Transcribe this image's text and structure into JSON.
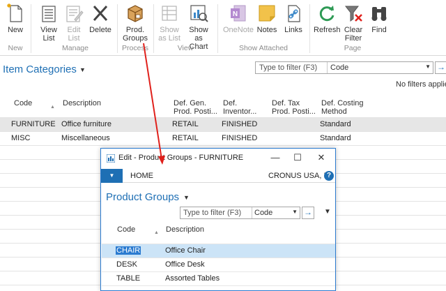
{
  "ribbon": {
    "buttons": [
      {
        "label": "New",
        "icon": "new-document-icon"
      },
      {
        "label": "View\nList",
        "icon": "view-list-icon"
      },
      {
        "label": "Edit\nList",
        "icon": "edit-list-icon"
      },
      {
        "label": "Delete",
        "icon": "delete-x-icon"
      },
      {
        "label": "Prod.\nGroups",
        "icon": "product-groups-box-icon"
      },
      {
        "label": "Show\nas List",
        "icon": "show-as-list-icon"
      },
      {
        "label": "Show as\nChart",
        "icon": "show-as-chart-icon"
      },
      {
        "label": "OneNote",
        "icon": "onenote-icon"
      },
      {
        "label": "Notes",
        "icon": "notes-icon"
      },
      {
        "label": "Links",
        "icon": "links-icon"
      },
      {
        "label": "Refresh",
        "icon": "refresh-icon"
      },
      {
        "label": "Clear\nFilter",
        "icon": "clear-filter-icon"
      },
      {
        "label": "Find",
        "icon": "find-binoculars-icon"
      }
    ],
    "groups": [
      "New",
      "Manage",
      "Process",
      "View",
      "Show Attached",
      "Page"
    ]
  },
  "page": {
    "title": "Item Categories",
    "filter_placeholder": "Type to filter (F3)",
    "filter_field": "Code",
    "no_filters": "No filters applie",
    "columns": [
      "Code",
      "Description",
      "Def. Gen.\nProd. Posti...",
      "Def.\nInventor...",
      "Def. Tax\nProd. Posti...",
      "Def. Costing\nMethod"
    ],
    "rows": [
      {
        "code": "FURNITURE",
        "description": "Office furniture",
        "gen_prod": "RETAIL",
        "inventory": "FINISHED",
        "tax": "",
        "costing": "Standard"
      },
      {
        "code": "MISC",
        "description": "Miscellaneous",
        "gen_prod": "RETAIL",
        "inventory": "FINISHED",
        "tax": "",
        "costing": "Standard"
      }
    ]
  },
  "dialog": {
    "title": "Edit - Product Groups - FURNITURE",
    "menu_tab": "HOME",
    "company": "CRONUS USA, I...",
    "help": "?",
    "page_title": "Product Groups",
    "filter_placeholder": "Type to filter (F3)",
    "filter_field": "Code",
    "columns": [
      "Code",
      "Description"
    ],
    "rows": [
      {
        "code": "CHAIR",
        "description": "Office Chair"
      },
      {
        "code": "DESK",
        "description": "Office Desk"
      },
      {
        "code": "TABLE",
        "description": "Assorted Tables"
      }
    ]
  },
  "colors": {
    "accent": "#1e6fb4",
    "selection_row": "#cce4f7",
    "selection_cell": "#2b7bd0",
    "annotation_arrow": "#e0201b"
  }
}
